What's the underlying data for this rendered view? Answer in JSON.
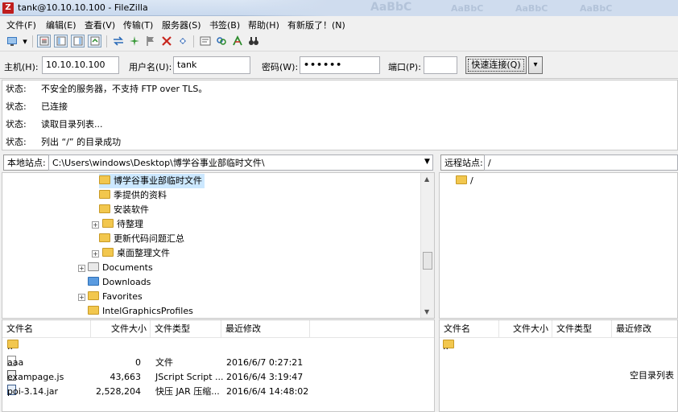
{
  "titlebar": {
    "app_icon": "Z",
    "title": "tank@10.10.10.100 - FileZilla",
    "ghost_text": [
      "AaBbC",
      "AaBbC",
      "AaBbC",
      "AaBbC"
    ]
  },
  "menu": {
    "items": [
      "文件(F)",
      "编辑(E)",
      "查看(V)",
      "传输(T)",
      "服务器(S)",
      "书签(B)",
      "帮助(H)",
      "有新版了！(N)"
    ]
  },
  "quickconnect": {
    "host_label": "主机(H):",
    "host_value": "10.10.10.100",
    "user_label": "用户名(U):",
    "user_value": "tank",
    "pass_label": "密码(W):",
    "pass_value": "••••••",
    "port_label": "端口(P):",
    "port_value": "",
    "connect_label": "快速连接(Q)",
    "dropdown_glyph": "▾"
  },
  "log": [
    {
      "key": "状态:",
      "text": "不安全的服务器，不支持 FTP over TLS。"
    },
    {
      "key": "状态:",
      "text": "已连接"
    },
    {
      "key": "状态:",
      "text": "读取目录列表..."
    },
    {
      "key": "状态:",
      "text": "列出 “/” 的目录成功"
    }
  ],
  "local": {
    "site_label": "本地站点:",
    "path": "C:\\Users\\windows\\Desktop\\博学谷事业部临时文件\\",
    "tree": [
      {
        "label": "博学谷事业部临时文件",
        "icon": "folder",
        "selected": true
      },
      {
        "label": "季提供的资料",
        "icon": "folder"
      },
      {
        "label": "安装软件",
        "icon": "folder"
      },
      {
        "label": "待整理",
        "icon": "folder",
        "expander": "+"
      },
      {
        "label": "更新代码问题汇总",
        "icon": "folder"
      },
      {
        "label": "桌面整理文件",
        "icon": "folder",
        "expander": "+"
      },
      {
        "label": "Documents",
        "icon": "documents",
        "expander": "+"
      },
      {
        "label": "Downloads",
        "icon": "downloads"
      },
      {
        "label": "Favorites",
        "icon": "favorites",
        "expander": "+"
      },
      {
        "label": "IntelGraphicsProfiles",
        "icon": "folder"
      }
    ],
    "columns": [
      "文件名",
      "文件大小",
      "文件类型",
      "最近修改"
    ],
    "files": [
      {
        "name": "..",
        "size": "",
        "type": "",
        "modified": "",
        "icon": "folder"
      },
      {
        "name": "aaa",
        "size": "0",
        "type": "文件",
        "modified": "2016/6/7 0:27:21",
        "icon": "file"
      },
      {
        "name": "exampage.js",
        "size": "43,663",
        "type": "JScript Script ...",
        "modified": "2016/6/4 3:19:47",
        "icon": "js"
      },
      {
        "name": "poi-3.14.jar",
        "size": "2,528,204",
        "type": "快压 JAR 压缩...",
        "modified": "2016/6/4 14:48:02",
        "icon": "jar"
      }
    ]
  },
  "remote": {
    "site_label": "远程站点:",
    "path": "/",
    "tree": [
      {
        "label": "/",
        "icon": "folder"
      }
    ],
    "columns": [
      "文件名",
      "文件大小",
      "文件类型",
      "最近修改"
    ],
    "files": [
      {
        "name": "..",
        "icon": "folder"
      }
    ],
    "empty_text": "空目录列表"
  }
}
